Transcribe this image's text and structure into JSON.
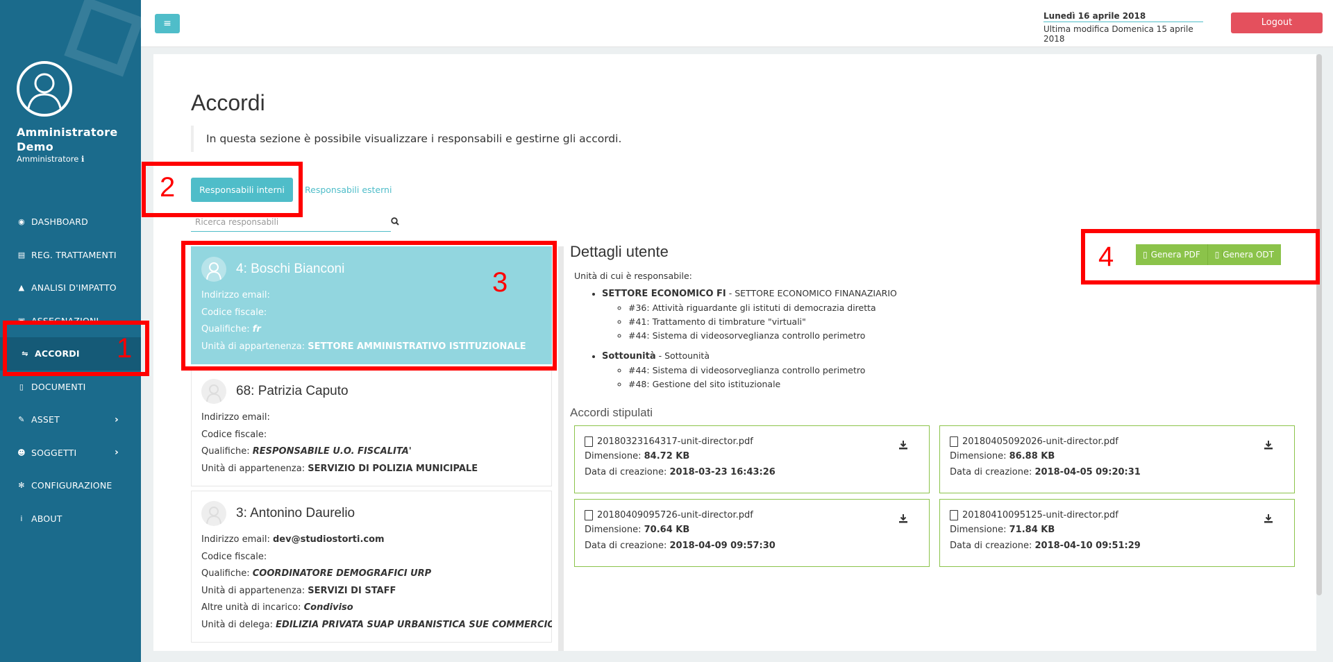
{
  "user": {
    "name": "Amministratore Demo",
    "role": "Amministratore"
  },
  "nav": [
    {
      "label": "DASHBOARD",
      "icon": "dashboard-icon",
      "glyph": "◉"
    },
    {
      "label": "REG. TRATTAMENTI",
      "icon": "book-icon",
      "glyph": "▤"
    },
    {
      "label": "ANALISI D'IMPATTO",
      "icon": "warning-icon",
      "glyph": "▲"
    },
    {
      "label": "ASSEGNAZIONI",
      "icon": "assignment-icon",
      "glyph": "▣"
    },
    {
      "label": "ACCORDI",
      "icon": "handshake-icon",
      "glyph": "⇋"
    },
    {
      "label": "DOCUMENTI",
      "icon": "document-icon",
      "glyph": "▯"
    },
    {
      "label": "ASSET",
      "icon": "edit-icon",
      "glyph": "✎"
    },
    {
      "label": "SOGGETTI",
      "icon": "users-icon",
      "glyph": "☻"
    },
    {
      "label": "CONFIGURAZIONE",
      "icon": "gear-icon",
      "glyph": "✻"
    },
    {
      "label": "ABOUT",
      "icon": "info-icon",
      "glyph": "i"
    }
  ],
  "header": {
    "date": "Lunedì 16 aprile 2018",
    "last_modified": "Ultima modifica Domenica 15 aprile 2018",
    "logout": "Logout"
  },
  "page": {
    "title": "Accordi",
    "description": "In questa sezione è possibile visualizzare i responsabili e gestirne gli accordi.",
    "tab_internal": "Responsabili interni",
    "tab_external": "Responsabili esterni",
    "search_placeholder": "Ricerca responsabili"
  },
  "labels": {
    "email": "Indirizzo email:",
    "fiscal": "Codice fiscale:",
    "qual": "Qualifiche:",
    "unit": "Unità di appartenenza:",
    "other_units": "Altre unità di incarico:",
    "delegate": "Unità di delega:"
  },
  "people": [
    {
      "name": "4: Boschi Bianconi",
      "email": "",
      "fiscal": "",
      "qual": "fr",
      "unit": "SETTORE AMMINISTRATIVO ISTITUZIONALE"
    },
    {
      "name": "68: Patrizia Caputo",
      "email": "",
      "fiscal": "",
      "qual": "RESPONSABILE U.O. FISCALITA'",
      "unit": "SERVIZIO DI POLIZIA MUNICIPALE"
    },
    {
      "name": "3: Antonino Daurelio",
      "email": "dev@studiostorti.com",
      "fiscal": "",
      "qual": "COORDINATORE DEMOGRAFICI URP",
      "unit": "SERVIZI DI STAFF",
      "other_units": "Condiviso",
      "delegate": "EDILIZIA PRIVATA SUAP URBANISTICA SUE COMMERCIO"
    }
  ],
  "details": {
    "title": "Dettagli utente",
    "gen_pdf": "Genera PDF",
    "gen_odt": "Genera ODT",
    "units_label": "Unità di cui è responsabile:",
    "units": [
      {
        "name": "SETTORE ECONOMICO FI",
        "desc": " - SETTORE ECONOMICO FINANAZIARIO",
        "items": [
          "#36: Attività riguardante gli istituti di democrazia diretta",
          "#41: Trattamento di timbrature \"virtuali\"",
          "#44: Sistema di videosorveglianza controllo perimetro"
        ]
      },
      {
        "name": "Sottounità",
        "desc": " - Sottounità",
        "items": [
          "#44: Sistema di videosorveglianza controllo perimetro",
          "#48: Gestione del sito istituzionale"
        ]
      }
    ],
    "agreements_title": "Accordi stipulati",
    "size_label": "Dimensione:",
    "created_label": "Data di creazione:",
    "agreements": [
      {
        "file": "20180323164317-unit-director.pdf",
        "size": "84.72 KB",
        "created": "2018-03-23 16:43:26"
      },
      {
        "file": "20180405092026-unit-director.pdf",
        "size": "86.88 KB",
        "created": "2018-04-05 09:20:31"
      },
      {
        "file": "20180409095726-unit-director.pdf",
        "size": "70.64 KB",
        "created": "2018-04-09 09:57:30"
      },
      {
        "file": "20180410095125-unit-director.pdf",
        "size": "71.84 KB",
        "created": "2018-04-10 09:51:29"
      }
    ]
  },
  "annotations": [
    "1",
    "2",
    "3",
    "4"
  ]
}
